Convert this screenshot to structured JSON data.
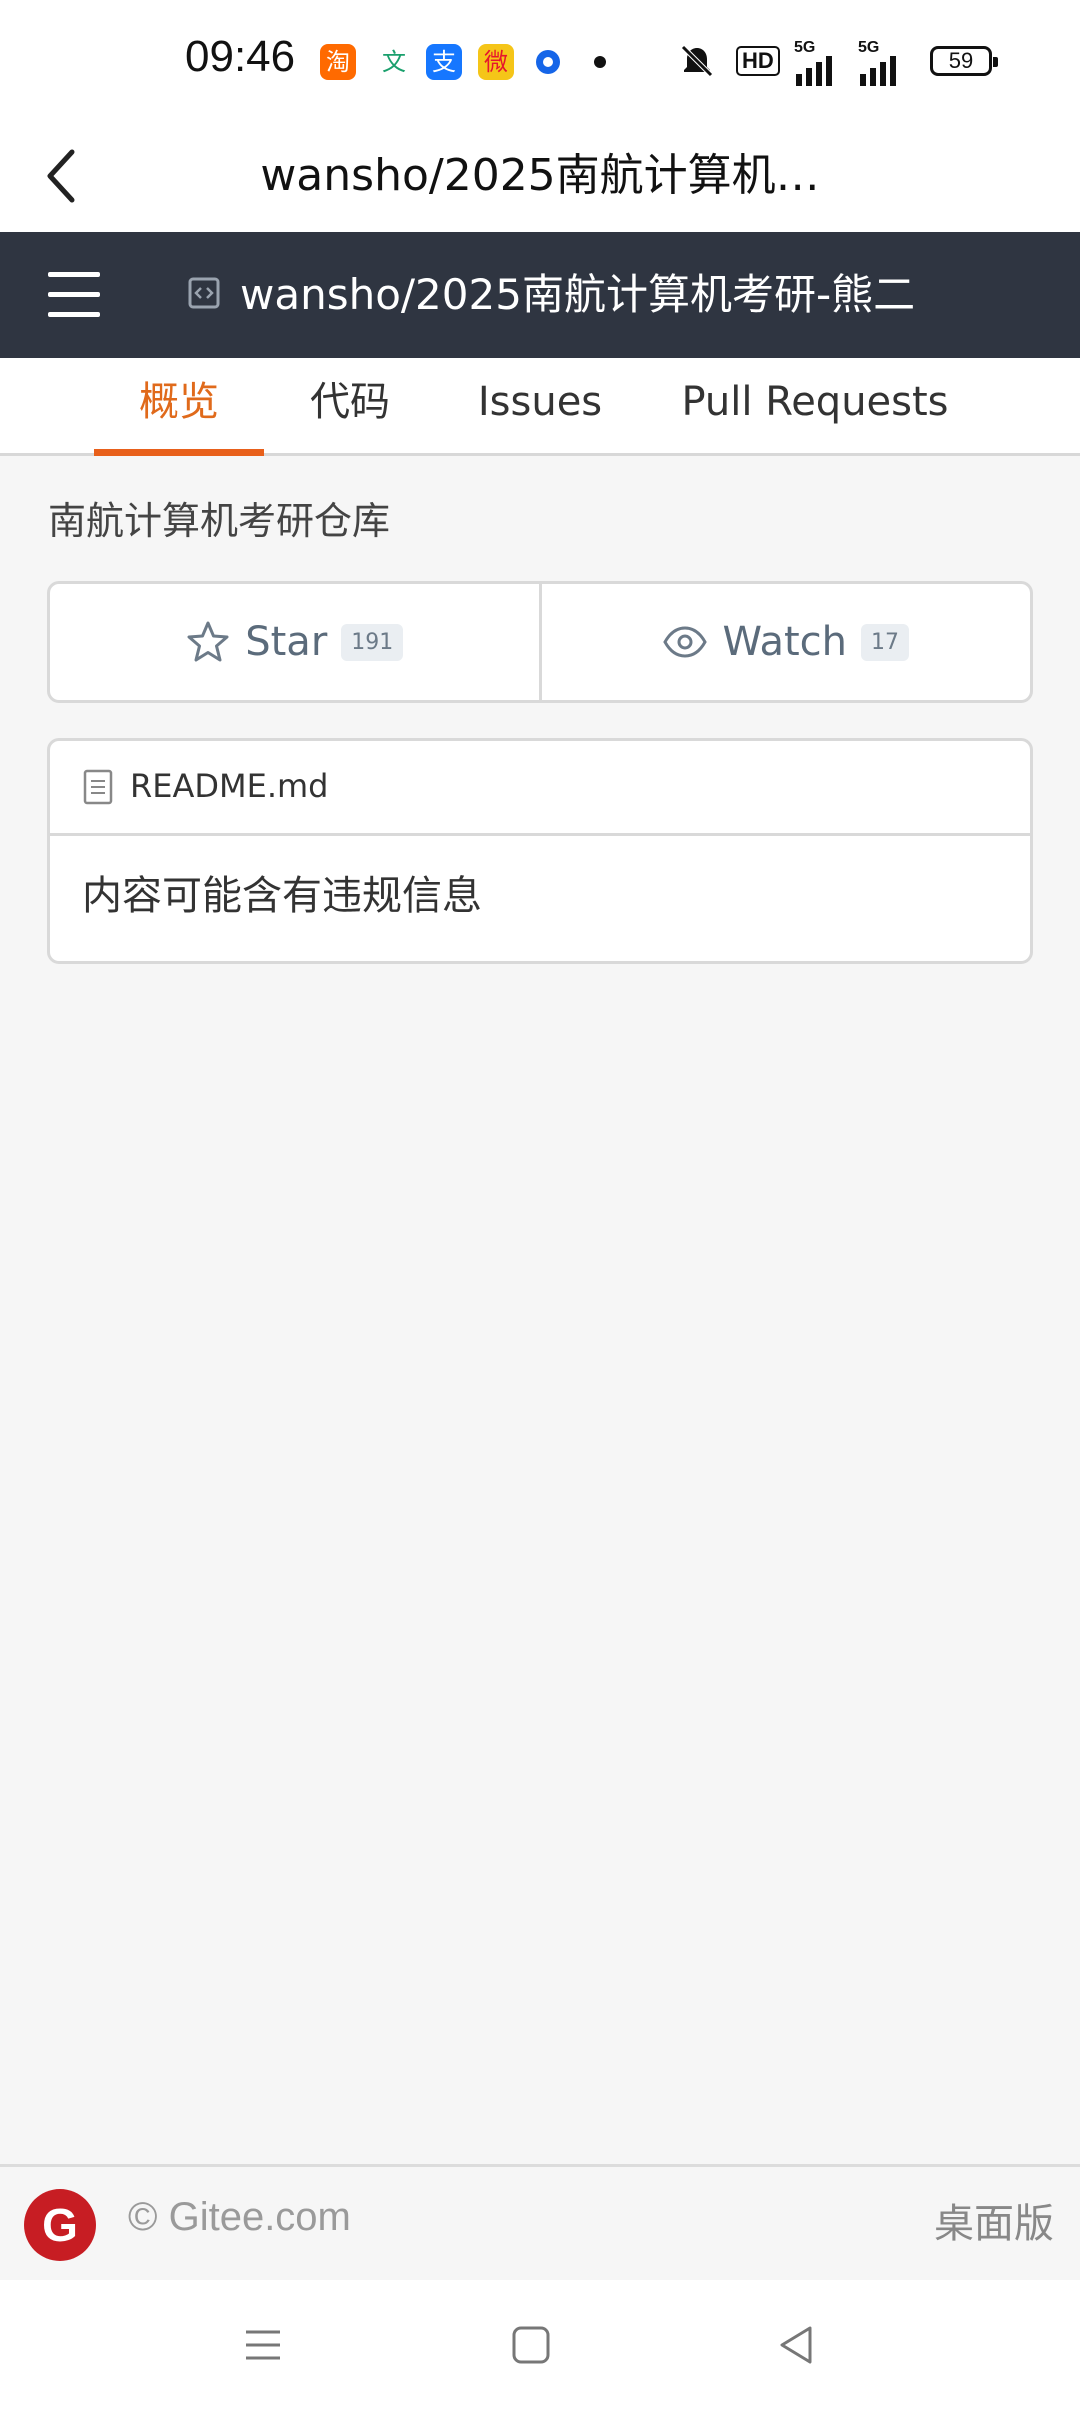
{
  "status_bar": {
    "time": "09:46",
    "apps": [
      "taobao-icon",
      "translate-icon",
      "alipay-icon",
      "weibo-icon",
      "browser-icon"
    ],
    "indicators": [
      "mute-icon",
      "HD",
      "5G",
      "5G"
    ],
    "battery": "59"
  },
  "titlebar": {
    "title": "wansho/2025南航计算机…"
  },
  "header": {
    "repo_title": "wansho/2025南航计算机考研-熊二"
  },
  "tabs": [
    {
      "label": "概览",
      "active": true
    },
    {
      "label": "代码",
      "active": false
    },
    {
      "label": "Issues",
      "active": false
    },
    {
      "label": "Pull Requests",
      "active": false
    }
  ],
  "repo": {
    "description": "南航计算机考研仓库",
    "star_label": "Star",
    "star_count": "191",
    "watch_label": "Watch",
    "watch_count": "17"
  },
  "readme": {
    "filename": "README.md",
    "content": "内容可能含有违规信息"
  },
  "footer": {
    "logo_letter": "G",
    "copyright": "© Gitee.com",
    "desktop_link": "桌面版"
  },
  "colors": {
    "header_bg": "#2f3541",
    "accent": "#e8601b",
    "gitee_red": "#c71d23"
  }
}
